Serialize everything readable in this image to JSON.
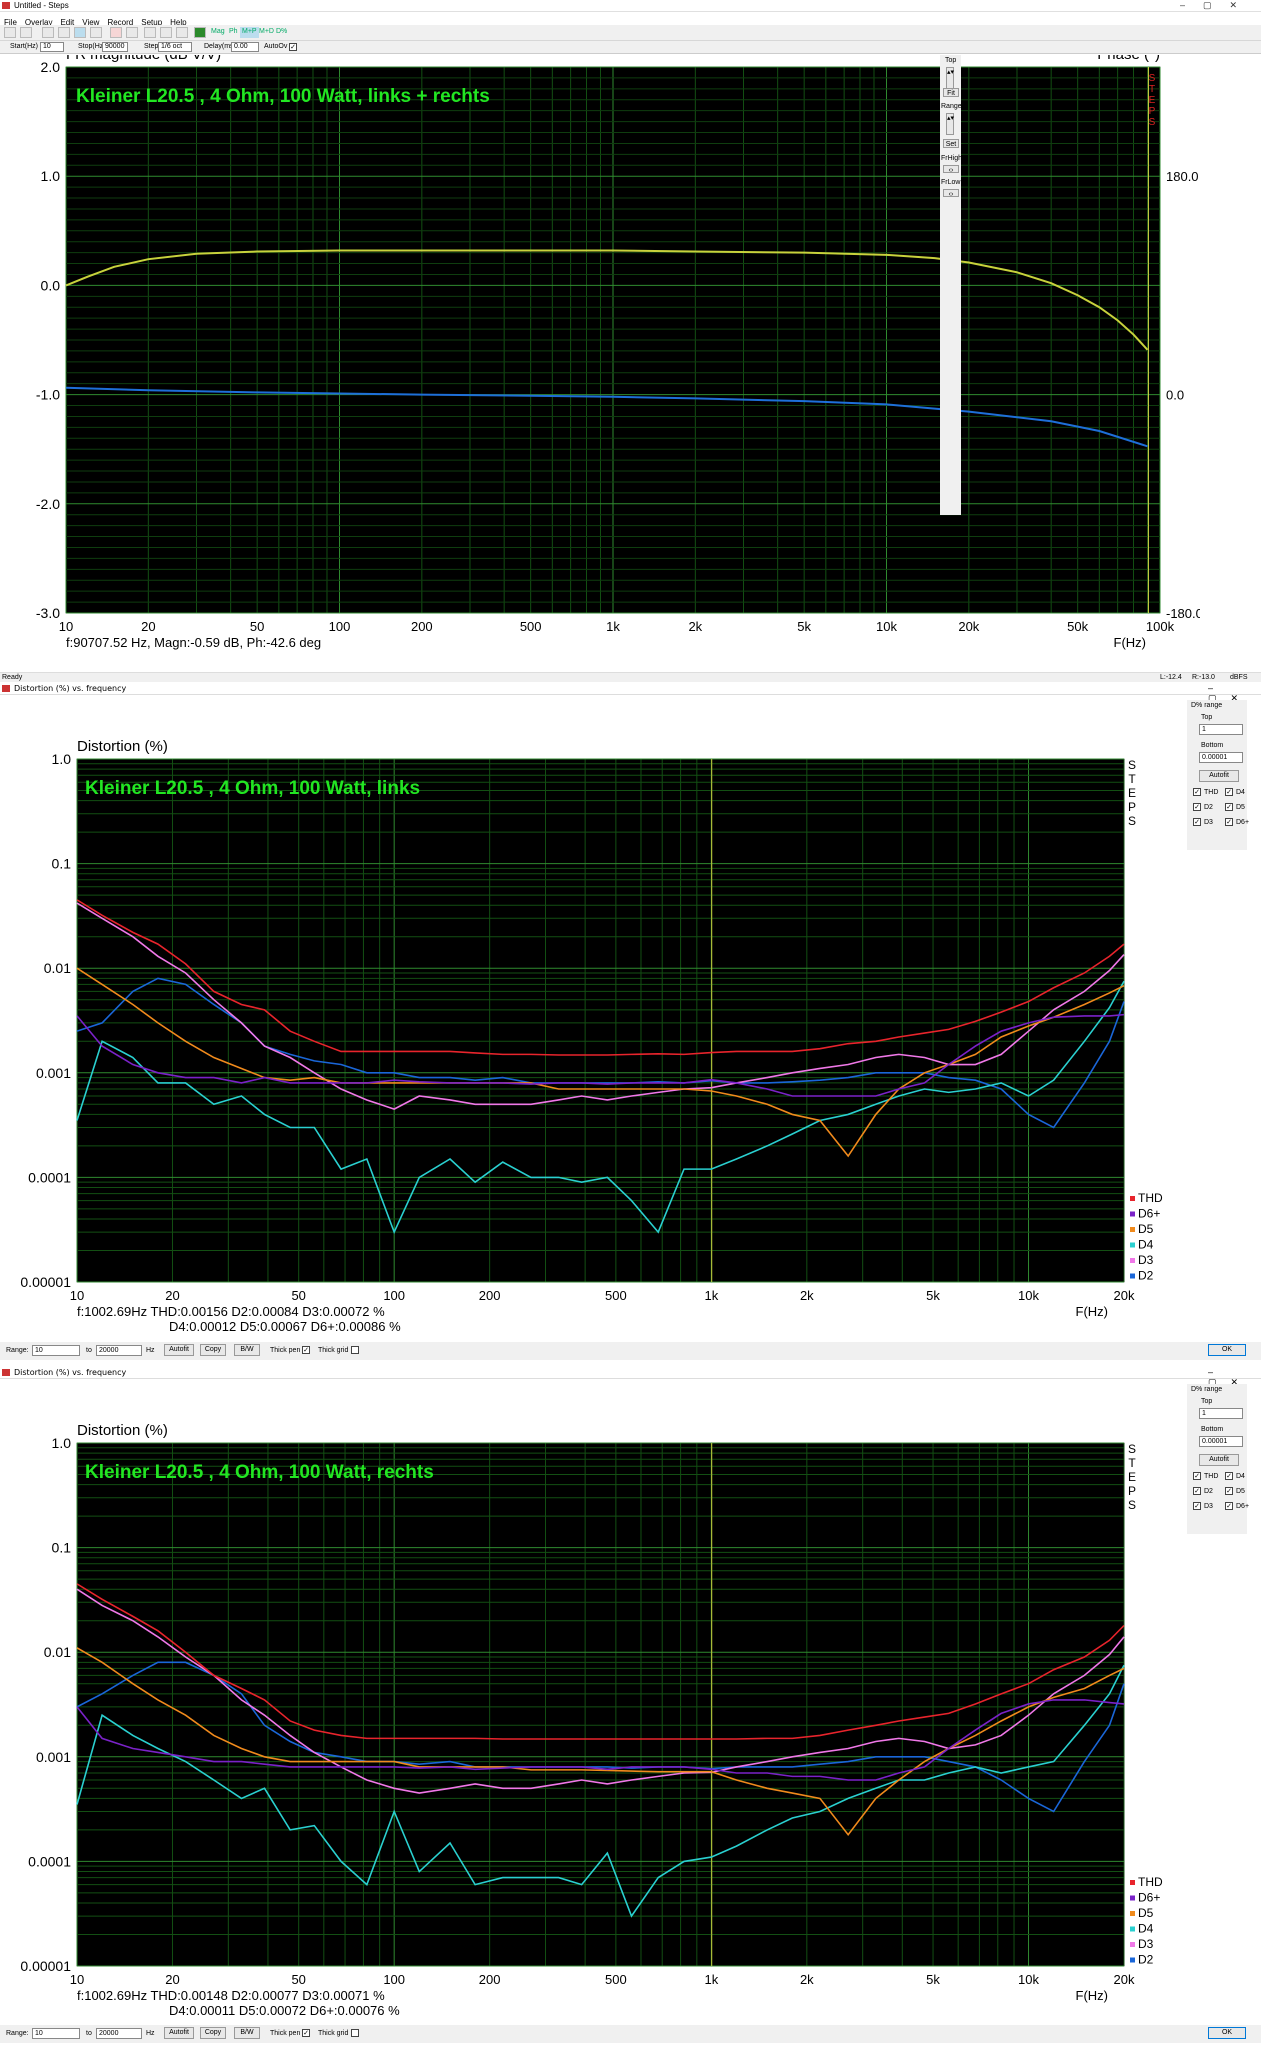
{
  "main_window": {
    "title": "Untitled - Steps",
    "menu": [
      "File",
      "Overlay",
      "Edit",
      "View",
      "Record",
      "Setup",
      "Help"
    ],
    "toolbar_text_buttons": [
      "Mag",
      "Ph",
      "M+P",
      "M+D",
      "D%"
    ],
    "params": {
      "start_label": "Start(Hz)",
      "start_value": "10",
      "stop_label": "Stop(Hz)",
      "stop_value": "90000",
      "step_label": "Step",
      "step_value": "1/6 oct",
      "delay_label": "Delay(ms)",
      "delay_value": "0.00",
      "autoov_label": "AutoOv"
    },
    "side_panel": {
      "top_label": "Top",
      "fit_label": "Fit",
      "range_label": "Range",
      "set_label": "Set",
      "frhigh_label": "FrHigh",
      "frlow_label": "FrLow"
    },
    "status_left": "Ready",
    "status_right_l": "L:-12.4",
    "status_right_r": "R:-13.0",
    "status_unit": "dBFS"
  },
  "fr_chart": {
    "y_title": "FR magnitude (dB V/V)",
    "y2_title": "Phase (°)",
    "annotation": "Kleiner L20.5 , 4 Ohm, 100 Watt, links + rechts",
    "cursor_readout": "f:90707.52 Hz, Magn:-0.59 dB, Ph:-42.6 deg",
    "x_unit": "F(Hz)",
    "phase_ticks": [
      "180.0",
      "0.0",
      "-180.0"
    ],
    "steps_label": "STEPS"
  },
  "chart_data": [
    {
      "type": "line",
      "x_scale": "log",
      "xlim": [
        10,
        100000
      ],
      "ylim": [
        -3,
        2
      ],
      "x_ticks": [
        "10",
        "20",
        "50",
        "100",
        "200",
        "500",
        "1k",
        "2k",
        "5k",
        "10k",
        "20k",
        "50k",
        "100k"
      ],
      "y_ticks": [
        "2.0",
        "1.0",
        "0.0",
        "-1.0",
        "-2.0",
        "-3.0"
      ],
      "y2_ticks": [
        "180.0",
        "0.0",
        "-180.0"
      ],
      "y2lim": [
        -180,
        180
      ],
      "series": [
        {
          "color": "#c8d23c",
          "x": [
            10,
            12,
            15,
            20,
            30,
            50,
            100,
            200,
            500,
            1000,
            2000,
            5000,
            10000,
            15000,
            20000,
            30000,
            40000,
            50000,
            60000,
            70000,
            80000,
            90000
          ],
          "y": [
            0.0,
            0.08,
            0.17,
            0.24,
            0.29,
            0.31,
            0.32,
            0.32,
            0.32,
            0.32,
            0.31,
            0.3,
            0.28,
            0.25,
            0.21,
            0.12,
            0.02,
            -0.09,
            -0.2,
            -0.32,
            -0.45,
            -0.59
          ]
        },
        {
          "color": "#1e6fd9",
          "x": [
            10,
            20,
            50,
            100,
            200,
            500,
            1000,
            2000,
            5000,
            10000,
            20000,
            40000,
            60000,
            90000
          ],
          "y": [
            5.6,
            3.6,
            1.8,
            0.9,
            0.0,
            -0.9,
            -1.8,
            -3.1,
            -5.4,
            -8.1,
            -14.0,
            -22.0,
            -30.0,
            -42.6
          ]
        }
      ]
    },
    {
      "type": "line",
      "x_scale": "log",
      "y_scale": "log",
      "xlim": [
        10,
        20000
      ],
      "ylim": [
        1e-05,
        1
      ],
      "x_ticks": [
        "10",
        "20",
        "50",
        "100",
        "200",
        "500",
        "1k",
        "2k",
        "5k",
        "10k",
        "20k"
      ],
      "y_ticks": [
        "1.0",
        "0.1",
        "0.01",
        "0.001",
        "0.0001",
        "0.00001"
      ],
      "x": [
        10,
        12,
        15,
        18,
        22,
        27,
        33,
        39,
        47,
        56,
        68,
        82,
        100,
        120,
        150,
        180,
        220,
        270,
        330,
        390,
        470,
        560,
        680,
        820,
        1000,
        1200,
        1500,
        1800,
        2200,
        2700,
        3300,
        3900,
        4700,
        5600,
        6800,
        8200,
        10000,
        12000,
        15000,
        18000,
        20000
      ],
      "series": [
        {
          "name": "THD",
          "color": "#e8242c",
          "y": [
            0.045,
            0.032,
            0.022,
            0.017,
            0.011,
            0.006,
            0.0045,
            0.004,
            0.0025,
            0.002,
            0.0016,
            0.0016,
            0.0016,
            0.0016,
            0.0016,
            0.00155,
            0.0015,
            0.0015,
            0.00148,
            0.00148,
            0.00148,
            0.0015,
            0.00152,
            0.0015,
            0.00156,
            0.0016,
            0.0016,
            0.0016,
            0.0017,
            0.0019,
            0.002,
            0.0022,
            0.0024,
            0.0026,
            0.0031,
            0.0038,
            0.0048,
            0.0065,
            0.009,
            0.013,
            0.017
          ]
        },
        {
          "name": "D6+",
          "color": "#7a22c8",
          "y": [
            0.0035,
            0.0018,
            0.0012,
            0.001,
            0.0009,
            0.0009,
            0.0008,
            0.0009,
            0.0008,
            0.0008,
            0.0008,
            0.0008,
            0.00085,
            0.00082,
            0.0008,
            0.0008,
            0.0008,
            0.00078,
            0.0008,
            0.0008,
            0.00078,
            0.0008,
            0.0008,
            0.0008,
            0.00086,
            0.0008,
            0.0007,
            0.0006,
            0.0006,
            0.0006,
            0.0006,
            0.0007,
            0.0008,
            0.0012,
            0.0018,
            0.0025,
            0.003,
            0.0034,
            0.0035,
            0.0035,
            0.0036
          ]
        },
        {
          "name": "D5",
          "color": "#f08a1c",
          "y": [
            0.01,
            0.007,
            0.0045,
            0.003,
            0.002,
            0.0014,
            0.0011,
            0.0009,
            0.00085,
            0.0009,
            0.0008,
            0.0008,
            0.0008,
            0.0008,
            0.0008,
            0.0008,
            0.0008,
            0.0008,
            0.0007,
            0.0007,
            0.0007,
            0.0007,
            0.0007,
            0.0007,
            0.00067,
            0.0006,
            0.0005,
            0.0004,
            0.00035,
            0.00016,
            0.0004,
            0.0007,
            0.001,
            0.0012,
            0.0015,
            0.0022,
            0.0028,
            0.0034,
            0.0045,
            0.0058,
            0.0068
          ]
        },
        {
          "name": "D4",
          "color": "#2ad0d0",
          "y": [
            0.00035,
            0.002,
            0.0014,
            0.0008,
            0.0008,
            0.0005,
            0.0006,
            0.0004,
            0.0003,
            0.0003,
            0.00012,
            0.00015,
            3e-05,
            0.0001,
            0.00015,
            9e-05,
            0.00014,
            0.0001,
            0.0001,
            9e-05,
            0.0001,
            6e-05,
            3e-05,
            0.00012,
            0.00012,
            0.00015,
            0.0002,
            0.00026,
            0.00035,
            0.0004,
            0.0005,
            0.0006,
            0.0007,
            0.00065,
            0.0007,
            0.0008,
            0.0006,
            0.00085,
            0.002,
            0.0042,
            0.0075
          ]
        },
        {
          "name": "D3",
          "color": "#f078e8",
          "y": [
            0.042,
            0.03,
            0.02,
            0.013,
            0.009,
            0.005,
            0.003,
            0.0018,
            0.0014,
            0.001,
            0.0007,
            0.00055,
            0.00045,
            0.0006,
            0.00055,
            0.0005,
            0.0005,
            0.0005,
            0.00055,
            0.0006,
            0.00055,
            0.0006,
            0.00065,
            0.0007,
            0.00072,
            0.0008,
            0.0009,
            0.001,
            0.0011,
            0.0012,
            0.0014,
            0.0015,
            0.0014,
            0.0012,
            0.0012,
            0.0015,
            0.0025,
            0.004,
            0.006,
            0.0095,
            0.0135
          ]
        },
        {
          "name": "D2",
          "color": "#1a66d8",
          "y": [
            0.0025,
            0.003,
            0.006,
            0.008,
            0.007,
            0.0045,
            0.003,
            0.0018,
            0.0015,
            0.0013,
            0.0012,
            0.001,
            0.001,
            0.0009,
            0.0009,
            0.00085,
            0.0009,
            0.0008,
            0.0008,
            0.0008,
            0.0008,
            0.0008,
            0.00082,
            0.0008,
            0.00084,
            0.0008,
            0.0008,
            0.00082,
            0.00085,
            0.0009,
            0.001,
            0.001,
            0.001,
            0.0009,
            0.00085,
            0.0007,
            0.0004,
            0.0003,
            0.0008,
            0.002,
            0.0048
          ]
        }
      ]
    },
    {
      "type": "line",
      "x_scale": "log",
      "y_scale": "log",
      "xlim": [
        10,
        20000
      ],
      "ylim": [
        1e-05,
        1
      ],
      "x_ticks": [
        "10",
        "20",
        "50",
        "100",
        "200",
        "500",
        "1k",
        "2k",
        "5k",
        "10k",
        "20k"
      ],
      "y_ticks": [
        "1.0",
        "0.1",
        "0.01",
        "0.001",
        "0.0001",
        "0.00001"
      ],
      "x": [
        10,
        12,
        15,
        18,
        22,
        27,
        33,
        39,
        47,
        56,
        68,
        82,
        100,
        120,
        150,
        180,
        220,
        270,
        330,
        390,
        470,
        560,
        680,
        820,
        1000,
        1200,
        1500,
        1800,
        2200,
        2700,
        3300,
        3900,
        4700,
        5600,
        6800,
        8200,
        10000,
        12000,
        15000,
        18000,
        20000
      ],
      "series": [
        {
          "name": "THD",
          "color": "#e8242c",
          "y": [
            0.045,
            0.032,
            0.022,
            0.016,
            0.01,
            0.006,
            0.0045,
            0.0035,
            0.0022,
            0.0018,
            0.0016,
            0.0015,
            0.0015,
            0.0015,
            0.0015,
            0.0015,
            0.00148,
            0.00148,
            0.00148,
            0.00148,
            0.00148,
            0.00148,
            0.00148,
            0.00148,
            0.00148,
            0.00148,
            0.0015,
            0.0015,
            0.0016,
            0.0018,
            0.002,
            0.0022,
            0.0024,
            0.0026,
            0.0032,
            0.004,
            0.005,
            0.0068,
            0.009,
            0.013,
            0.018
          ]
        },
        {
          "name": "D6+",
          "color": "#7a22c8",
          "y": [
            0.003,
            0.0015,
            0.0012,
            0.0011,
            0.001,
            0.0009,
            0.0009,
            0.00085,
            0.0008,
            0.0008,
            0.0008,
            0.0008,
            0.0008,
            0.00078,
            0.0008,
            0.00076,
            0.00078,
            0.0008,
            0.0008,
            0.0008,
            0.00076,
            0.0008,
            0.0008,
            0.0008,
            0.00076,
            0.0007,
            0.0007,
            0.00065,
            0.00065,
            0.0006,
            0.0006,
            0.0007,
            0.0008,
            0.0012,
            0.0018,
            0.0026,
            0.0032,
            0.0035,
            0.0035,
            0.0033,
            0.0032
          ]
        },
        {
          "name": "D5",
          "color": "#f08a1c",
          "y": [
            0.011,
            0.008,
            0.005,
            0.0035,
            0.0025,
            0.0016,
            0.0012,
            0.001,
            0.0009,
            0.0009,
            0.0009,
            0.0009,
            0.0009,
            0.0008,
            0.0008,
            0.0008,
            0.0008,
            0.00075,
            0.00075,
            0.00075,
            0.00074,
            0.00073,
            0.00072,
            0.00072,
            0.00072,
            0.0006,
            0.0005,
            0.00045,
            0.0004,
            0.00018,
            0.0004,
            0.0006,
            0.0009,
            0.0012,
            0.0016,
            0.0022,
            0.003,
            0.0037,
            0.0045,
            0.006,
            0.007
          ]
        },
        {
          "name": "D4",
          "color": "#2ad0d0",
          "y": [
            0.00035,
            0.0025,
            0.0016,
            0.0012,
            0.0009,
            0.0006,
            0.0004,
            0.0005,
            0.0002,
            0.00022,
            0.0001,
            6e-05,
            0.0003,
            8e-05,
            0.00015,
            6e-05,
            7e-05,
            7e-05,
            7e-05,
            6e-05,
            0.00012,
            3e-05,
            7e-05,
            0.0001,
            0.00011,
            0.00014,
            0.0002,
            0.00026,
            0.0003,
            0.0004,
            0.0005,
            0.0006,
            0.0006,
            0.0007,
            0.0008,
            0.0007,
            0.0008,
            0.0009,
            0.002,
            0.004,
            0.0075
          ]
        },
        {
          "name": "D3",
          "color": "#f078e8",
          "y": [
            0.04,
            0.028,
            0.02,
            0.014,
            0.009,
            0.006,
            0.0035,
            0.0025,
            0.0016,
            0.0011,
            0.0008,
            0.0006,
            0.0005,
            0.00045,
            0.0005,
            0.00055,
            0.0005,
            0.0005,
            0.00055,
            0.0006,
            0.00055,
            0.0006,
            0.00065,
            0.0007,
            0.00071,
            0.0008,
            0.0009,
            0.001,
            0.0011,
            0.0012,
            0.0014,
            0.0015,
            0.0014,
            0.0012,
            0.0013,
            0.0016,
            0.0025,
            0.004,
            0.006,
            0.0095,
            0.014
          ]
        },
        {
          "name": "D2",
          "color": "#1a66d8",
          "y": [
            0.003,
            0.004,
            0.006,
            0.008,
            0.008,
            0.006,
            0.004,
            0.002,
            0.0014,
            0.0011,
            0.001,
            0.0009,
            0.0009,
            0.00085,
            0.0009,
            0.0008,
            0.0008,
            0.0008,
            0.0008,
            0.0008,
            0.0008,
            0.00078,
            0.0008,
            0.0008,
            0.00077,
            0.0008,
            0.0008,
            0.0008,
            0.00085,
            0.0009,
            0.001,
            0.001,
            0.001,
            0.0009,
            0.0008,
            0.0006,
            0.0004,
            0.0003,
            0.0009,
            0.002,
            0.005
          ]
        }
      ]
    }
  ],
  "dist_left": {
    "window_title": "Distortion (%) vs. frequency",
    "y_title": "Distortion (%)",
    "annotation": "Kleiner L20.5 , 4 Ohm, 100 Watt, links",
    "readout1": "f:1002.69Hz    THD:0.00156  D2:0.00084   D3:0.00072 %",
    "readout2": "D4:0.00012  D5:0.00067  D6+:0.00086 %",
    "x_unit": "F(Hz)",
    "steps_label": "STEPS",
    "legend": [
      "THD",
      "D6+",
      "D5",
      "D4",
      "D3",
      "D2"
    ],
    "panel": {
      "range_title": "D% range",
      "top_label": "Top",
      "top_value": "1",
      "bottom_label": "Bottom",
      "bottom_value": "0.00001",
      "autofit_label": "Autofit",
      "checks": [
        "THD",
        "D4",
        "D2",
        "D5",
        "D3",
        "D6+"
      ]
    },
    "bottom": {
      "range_label": "Range:",
      "from_value": "10",
      "to_label": "to",
      "to_value": "20000",
      "hz_label": "Hz",
      "autofit_label": "Autofit",
      "copy_label": "Copy",
      "bw_label": "B/W",
      "thickpen_label": "Thick pen",
      "thickgrid_label": "Thick grid",
      "ok_label": "OK"
    }
  },
  "dist_right": {
    "window_title": "Distortion (%) vs. frequency",
    "y_title": "Distortion (%)",
    "annotation": "Kleiner L20.5 , 4 Ohm, 100 Watt, rechts",
    "readout1": "f:1002.69Hz    THD:0.00148  D2:0.00077   D3:0.00071 %",
    "readout2": "D4:0.00011  D5:0.00072  D6+:0.00076 %",
    "x_unit": "F(Hz)",
    "steps_label": "STEPS",
    "legend": [
      "THD",
      "D6+",
      "D5",
      "D4",
      "D3",
      "D2"
    ],
    "panel": {
      "range_title": "D% range",
      "top_label": "Top",
      "top_value": "1",
      "bottom_label": "Bottom",
      "bottom_value": "0.00001",
      "autofit_label": "Autofit",
      "checks": [
        "THD",
        "D4",
        "D2",
        "D5",
        "D3",
        "D6+"
      ]
    },
    "bottom": {
      "range_label": "Range:",
      "from_value": "10",
      "to_label": "to",
      "to_value": "20000",
      "hz_label": "Hz",
      "autofit_label": "Autofit",
      "copy_label": "Copy",
      "bw_label": "B/W",
      "thickpen_label": "Thick pen",
      "thickgrid_label": "Thick grid",
      "ok_label": "OK"
    }
  }
}
